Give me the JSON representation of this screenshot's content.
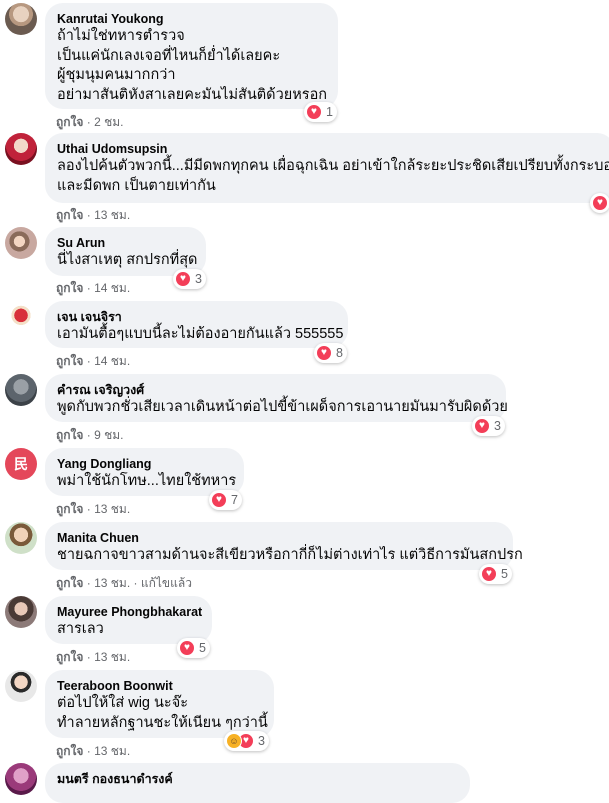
{
  "comments": [
    {
      "author": "Kanrutai Youkong",
      "lines": [
        "ถ้าไม่ใช่ทหารตำรวจ",
        "เป็นแค่นักเลงเจอที่ไหนก็ย่ำได้เลยคะ",
        "ผู้ชุมนุมคนมากกว่า",
        "อย่ามาสันติหังสาเลยคะมันไม่สันติด้วยหรอก"
      ],
      "reaction_count": "1",
      "like_label": "ถูกใจ",
      "time": "2 ชม."
    },
    {
      "author": "Uthai Udomsupsin",
      "lines": [
        "ลองไปค้นตัวพวกนี้...มีมีดพกทุกคน เผื่อฉุกเฉิน อย่าเข้าใกล้ระยะประชิดเสียเปรียบทั้งกระบอง",
        "และมีดพก เป็นตายเท่ากัน"
      ],
      "reaction_count": "",
      "like_label": "ถูกใจ",
      "time": "13 ชม."
    },
    {
      "author": "Su Arun",
      "lines": [
        "นี่ไงสาเหตุ สกปรกที่สุด"
      ],
      "reaction_count": "3",
      "like_label": "ถูกใจ",
      "time": "14 ชม."
    },
    {
      "author": "เจน เจนจิรา",
      "lines": [
        "เอามันตื้อๆแบบนี้ละไม่ต้องอายกันแล้ว 555555"
      ],
      "reaction_count": "8",
      "like_label": "ถูกใจ",
      "time": "14 ชม."
    },
    {
      "author": "คำรณ เจริญวงศ์",
      "lines": [
        "พูดกับพวกชั่วเสียเวลาเดินหน้าต่อไปขี้ข้าเผด็จการเอานายมันมารับผิดด้วย"
      ],
      "reaction_count": "3",
      "like_label": "ถูกใจ",
      "time": "9 ชม."
    },
    {
      "author": "Yang Dongliang",
      "lines": [
        "พม่าใช้นักโทษ...ไทยใช้ทหาร"
      ],
      "reaction_count": "7",
      "like_label": "ถูกใจ",
      "time": "13 ชม.",
      "avatar_initial": "民"
    },
    {
      "author": "Manita Chuen",
      "lines": [
        "ชายฉกาจขาวสามด้านจะสีเขียวหรือกากี่ก็ไม่ต่างเท่าไร แต่วิธีการมันสกปรก"
      ],
      "reaction_count": "5",
      "like_label": "ถูกใจ",
      "time": "13 ชม.",
      "edited": "แก้ไขแล้ว"
    },
    {
      "author": "Mayuree Phongbhakarat",
      "lines": [
        "สารเลว"
      ],
      "reaction_count": "5",
      "like_label": "ถูกใจ",
      "time": "13 ชม."
    },
    {
      "author": "Teeraboon Boonwit",
      "lines": [
        "ต่อไปให้ใส่ wig นะจ๊ะ",
        "ทำลายหลักฐานชะให้เนียน ๆกว่านี้"
      ],
      "reaction_count": "3",
      "like_label": "ถูกใจ",
      "time": "13 ชม."
    },
    {
      "author": "มนตรี กองธนาดำรงค์",
      "lines": [],
      "reaction_count": "",
      "like_label": "",
      "time": ""
    }
  ],
  "colors": {
    "bubble": "#f0f2f5",
    "meta_text": "#65676b",
    "heart": "#f33e58",
    "haha": "#f7b125",
    "avatar_initial_bg": "#e4475a"
  },
  "icons": [
    "heart-reaction-icon",
    "haha-reaction-icon"
  ]
}
